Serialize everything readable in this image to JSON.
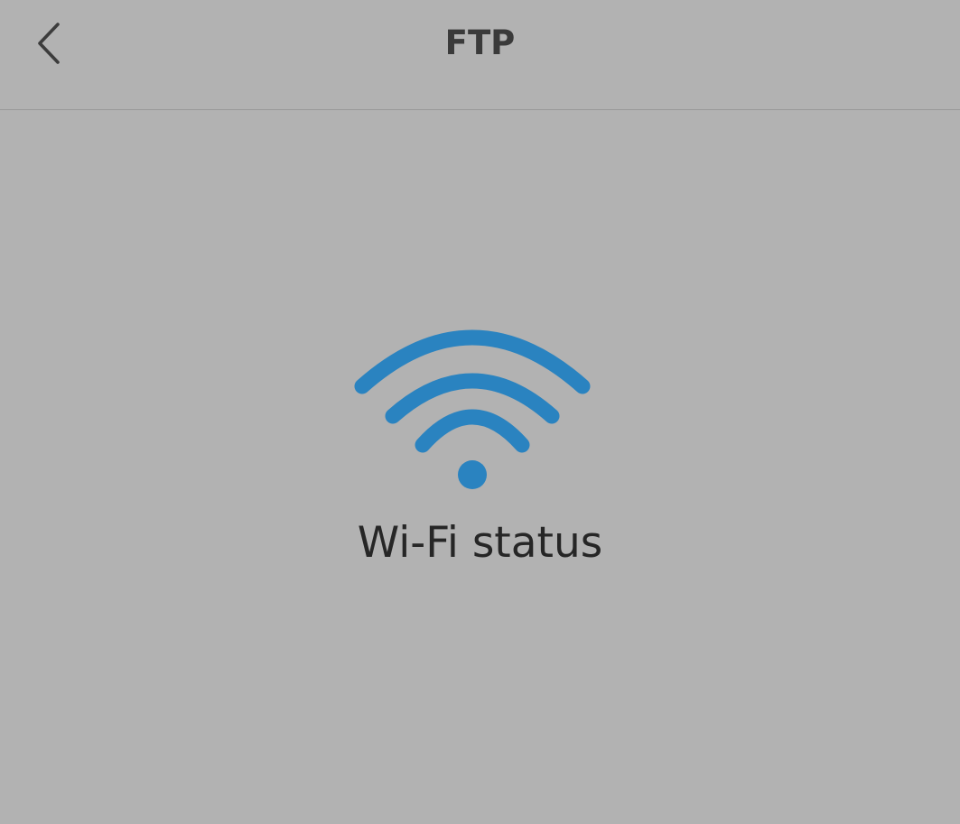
{
  "header": {
    "title": "FTP",
    "back_icon": "chevron-left-icon"
  },
  "main": {
    "status_label": "Wi-Fi status",
    "status_icon": "wifi-icon"
  },
  "colors": {
    "background": "#b2b2b2",
    "accent": "#2a83c0",
    "title_text": "#3a3a3a",
    "body_text": "#262626"
  }
}
